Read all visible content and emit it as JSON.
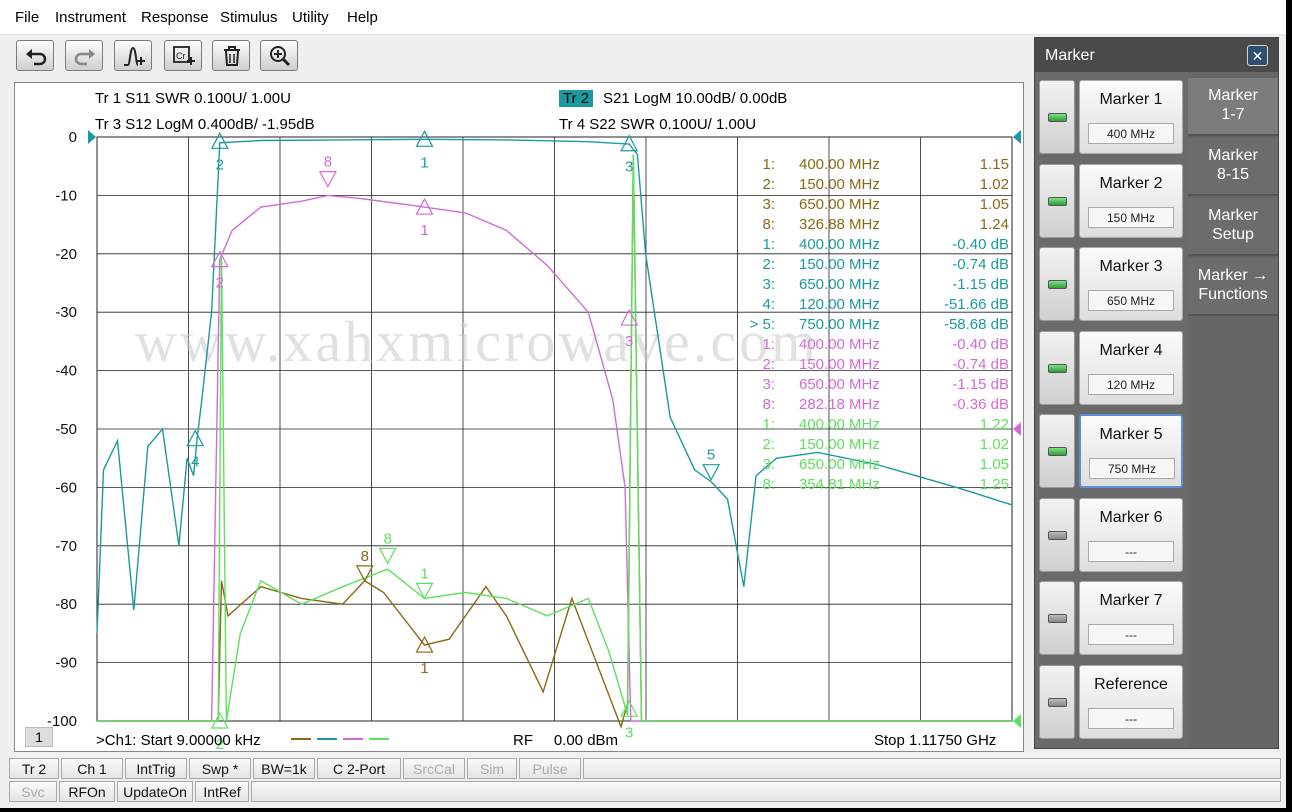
{
  "menu": [
    "File",
    "Instrument",
    "Response",
    "Stimulus",
    "Utility",
    "Help"
  ],
  "toolbar": {
    "buttons": [
      "undo-icon",
      "redo-icon",
      "marker-add-icon",
      "copy-trace-icon",
      "delete-icon",
      "zoom-icon"
    ]
  },
  "traces": {
    "tr1": "Tr 1   S11 SWR 0.100U/  1.00U",
    "tr2_label": "Tr 2",
    "tr2": "S21 LogM 10.00dB/  0.00dB",
    "tr3": "Tr 3   S12 LogM 0.400dB/  -1.95dB",
    "tr4": "Tr 4   S22 SWR 0.100U/  1.00U"
  },
  "colors": {
    "tr1": "#8b6914",
    "tr2": "#1a9aa0",
    "tr3": "#d46ad8",
    "tr4": "#5ee05e",
    "tr2_badge": "#1a9aa0"
  },
  "y_ticks": [
    "0",
    "-10",
    "-20",
    "-30",
    "-40",
    "-50",
    "-60",
    "-70",
    "-80",
    "-90",
    "-100"
  ],
  "marker_table": [
    {
      "idx": "1:",
      "freq": "400.00 MHz",
      "val": "1.15",
      "trace": "tr1"
    },
    {
      "idx": "2:",
      "freq": "150.00 MHz",
      "val": "1.02",
      "trace": "tr1"
    },
    {
      "idx": "3:",
      "freq": "650.00 MHz",
      "val": "1.05",
      "trace": "tr1"
    },
    {
      "idx": "8:",
      "freq": "326.88 MHz",
      "val": "1.24",
      "trace": "tr1"
    },
    {
      "idx": "1:",
      "freq": "400.00 MHz",
      "val": "-0.40 dB",
      "trace": "tr2"
    },
    {
      "idx": "2:",
      "freq": "150.00 MHz",
      "val": "-0.74 dB",
      "trace": "tr2"
    },
    {
      "idx": "3:",
      "freq": "650.00 MHz",
      "val": "-1.15 dB",
      "trace": "tr2"
    },
    {
      "idx": "4:",
      "freq": "120.00 MHz",
      "val": "-51.66 dB",
      "trace": "tr2"
    },
    {
      "idx": "> 5:",
      "freq": "750.00 MHz",
      "val": "-58.68 dB",
      "trace": "tr2"
    },
    {
      "idx": "1:",
      "freq": "400.00 MHz",
      "val": "-0.40 dB",
      "trace": "tr3"
    },
    {
      "idx": "2:",
      "freq": "150.00 MHz",
      "val": "-0.74 dB",
      "trace": "tr3"
    },
    {
      "idx": "3:",
      "freq": "650.00 MHz",
      "val": "-1.15 dB",
      "trace": "tr3"
    },
    {
      "idx": "8:",
      "freq": "282.18 MHz",
      "val": "-0.36 dB",
      "trace": "tr3"
    },
    {
      "idx": "1:",
      "freq": "400.00 MHz",
      "val": "1.22",
      "trace": "tr4"
    },
    {
      "idx": "2:",
      "freq": "150.00 MHz",
      "val": "1.02",
      "trace": "tr4"
    },
    {
      "idx": "3:",
      "freq": "650.00 MHz",
      "val": "1.05",
      "trace": "tr4"
    },
    {
      "idx": "8:",
      "freq": "354.81 MHz",
      "val": "1.25",
      "trace": "tr4"
    }
  ],
  "watermark": "www.xahxmicrowave.com",
  "footer": {
    "channel_box": "1",
    "start": ">Ch1:  Start  9.00000 kHz",
    "rf": "RF     0.00 dBm",
    "stop": "Stop  1.11750 GHz"
  },
  "chart_data": {
    "type": "line",
    "x_range_mhz": [
      0.009,
      1117.5
    ],
    "ylim": [
      -100,
      0
    ],
    "y_unit": "dB",
    "grid": true,
    "series": [
      {
        "name": "S11 SWR",
        "trace": "Tr 1",
        "x_mhz": [
          0,
          148,
          152,
          160,
          200,
          250,
          300,
          327,
          350,
          400,
          430,
          475,
          500,
          545,
          580,
          640,
          648,
          655,
          665,
          700,
          1117.5
        ],
        "y": [
          -100,
          -100,
          -76,
          -82,
          -77,
          -79,
          -80,
          -76,
          -78,
          -87,
          -86,
          -77,
          -82,
          -95,
          -79,
          -101,
          -97,
          -3,
          -100,
          -100,
          -100
        ]
      },
      {
        "name": "S21 LogM",
        "trace": "Tr 2",
        "x_mhz": [
          0,
          8,
          25,
          45,
          62,
          80,
          100,
          110,
          118,
          122,
          128,
          140,
          150,
          200,
          300,
          400,
          500,
          600,
          650,
          660,
          670,
          700,
          730,
          750,
          770,
          790,
          805,
          830,
          880,
          950,
          1050,
          1117.5
        ],
        "y": [
          -85,
          -57,
          -52,
          -81,
          -53,
          -50,
          -70,
          -55,
          -58,
          -52,
          -45,
          -30,
          -1,
          -0.6,
          -0.5,
          -0.4,
          -0.5,
          -0.8,
          -1.2,
          -3,
          -20,
          -48,
          -57,
          -59,
          -62,
          -77,
          -58,
          -55,
          -54,
          -56,
          -60,
          -63
        ]
      },
      {
        "name": "S12 LogM",
        "trace": "Tr 3",
        "x_mhz": [
          0,
          140,
          150,
          165,
          200,
          250,
          282,
          320,
          400,
          450,
          500,
          550,
          600,
          630,
          645,
          652,
          660,
          1117.5
        ],
        "y": [
          -100,
          -100,
          -21,
          -16,
          -12,
          -11,
          -10,
          -10.5,
          -12,
          -13,
          -16,
          -22,
          -30,
          -45,
          -60,
          -100,
          -100,
          -100
        ]
      },
      {
        "name": "S22 SWR",
        "trace": "Tr 4",
        "x_mhz": [
          0,
          148,
          152,
          158,
          175,
          200,
          250,
          300,
          355,
          400,
          450,
          500,
          550,
          600,
          625,
          648,
          655,
          665,
          1117.5
        ],
        "y": [
          -100,
          -100,
          -20,
          -100,
          -85,
          -76,
          -80,
          -77,
          -74,
          -79,
          -78,
          -79,
          -82,
          -79,
          -88,
          -99,
          -3,
          -100,
          -100
        ]
      }
    ],
    "markers": [
      {
        "trace": "Tr 1",
        "label": "1",
        "x_mhz": 400,
        "y": -87,
        "dir": "up"
      },
      {
        "trace": "Tr 1",
        "label": "8",
        "x_mhz": 327,
        "y": -76,
        "dir": "down"
      },
      {
        "trace": "Tr 2",
        "label": "1",
        "x_mhz": 400,
        "y": -0.4,
        "dir": "up"
      },
      {
        "trace": "Tr 2",
        "label": "2",
        "x_mhz": 150,
        "y": -0.74,
        "dir": "up"
      },
      {
        "trace": "Tr 2",
        "label": "3",
        "x_mhz": 650,
        "y": -1.15,
        "dir": "up"
      },
      {
        "trace": "Tr 2",
        "label": "4",
        "x_mhz": 120,
        "y": -51.66,
        "dir": "up"
      },
      {
        "trace": "Tr 2",
        "label": "5",
        "x_mhz": 750,
        "y": -58.68,
        "dir": "down"
      },
      {
        "trace": "Tr 3",
        "label": "1",
        "x_mhz": 400,
        "y": -12,
        "dir": "up"
      },
      {
        "trace": "Tr 3",
        "label": "2",
        "x_mhz": 150,
        "y": -21,
        "dir": "up"
      },
      {
        "trace": "Tr 3",
        "label": "3",
        "x_mhz": 650,
        "y": -31,
        "dir": "up"
      },
      {
        "trace": "Tr 3",
        "label": "8",
        "x_mhz": 282,
        "y": -8.5,
        "dir": "down"
      },
      {
        "trace": "Tr 4",
        "label": "1",
        "x_mhz": 400,
        "y": -79,
        "dir": "down"
      },
      {
        "trace": "Tr 4",
        "label": "2",
        "x_mhz": 150,
        "y": -100,
        "dir": "up"
      },
      {
        "trace": "Tr 4",
        "label": "3",
        "x_mhz": 650,
        "y": -98,
        "dir": "up"
      },
      {
        "trace": "Tr 4",
        "label": "8",
        "x_mhz": 355,
        "y": -73,
        "dir": "down"
      }
    ]
  },
  "side_panel": {
    "title": "Marker",
    "close": "✕",
    "markers": [
      {
        "name": "Marker 1",
        "value": "400 MHz",
        "on": true
      },
      {
        "name": "Marker 2",
        "value": "150 MHz",
        "on": true
      },
      {
        "name": "Marker 3",
        "value": "650 MHz",
        "on": true
      },
      {
        "name": "Marker 4",
        "value": "120 MHz",
        "on": true
      },
      {
        "name": "Marker 5",
        "value": "750 MHz",
        "on": true,
        "active": true
      },
      {
        "name": "Marker 6",
        "value": "---",
        "on": false
      },
      {
        "name": "Marker 7",
        "value": "---",
        "on": false
      },
      {
        "name": "Reference",
        "value": "---",
        "on": false
      }
    ],
    "tabs": [
      {
        "l1": "Marker",
        "l2": "1-7",
        "active": true
      },
      {
        "l1": "Marker",
        "l2": "8-15"
      },
      {
        "l1": "Marker",
        "l2": "Setup"
      },
      {
        "l1": "Marker →",
        "l2": "Functions"
      }
    ]
  },
  "status_row1": [
    {
      "label": "Tr 2",
      "dim": false
    },
    {
      "label": "Ch 1",
      "dim": false
    },
    {
      "label": "IntTrig",
      "dim": false
    },
    {
      "label": "Swp *",
      "dim": false
    },
    {
      "label": "BW=1k",
      "dim": false
    },
    {
      "label": "C  2-Port",
      "dim": false
    },
    {
      "label": "SrcCal",
      "dim": true
    },
    {
      "label": "Sim",
      "dim": true
    },
    {
      "label": "Pulse",
      "dim": true
    }
  ],
  "status_row2": [
    {
      "label": "Svc",
      "dim": true
    },
    {
      "label": "RFOn",
      "dim": false
    },
    {
      "label": "UpdateOn",
      "dim": false
    },
    {
      "label": "IntRef",
      "dim": false
    }
  ]
}
